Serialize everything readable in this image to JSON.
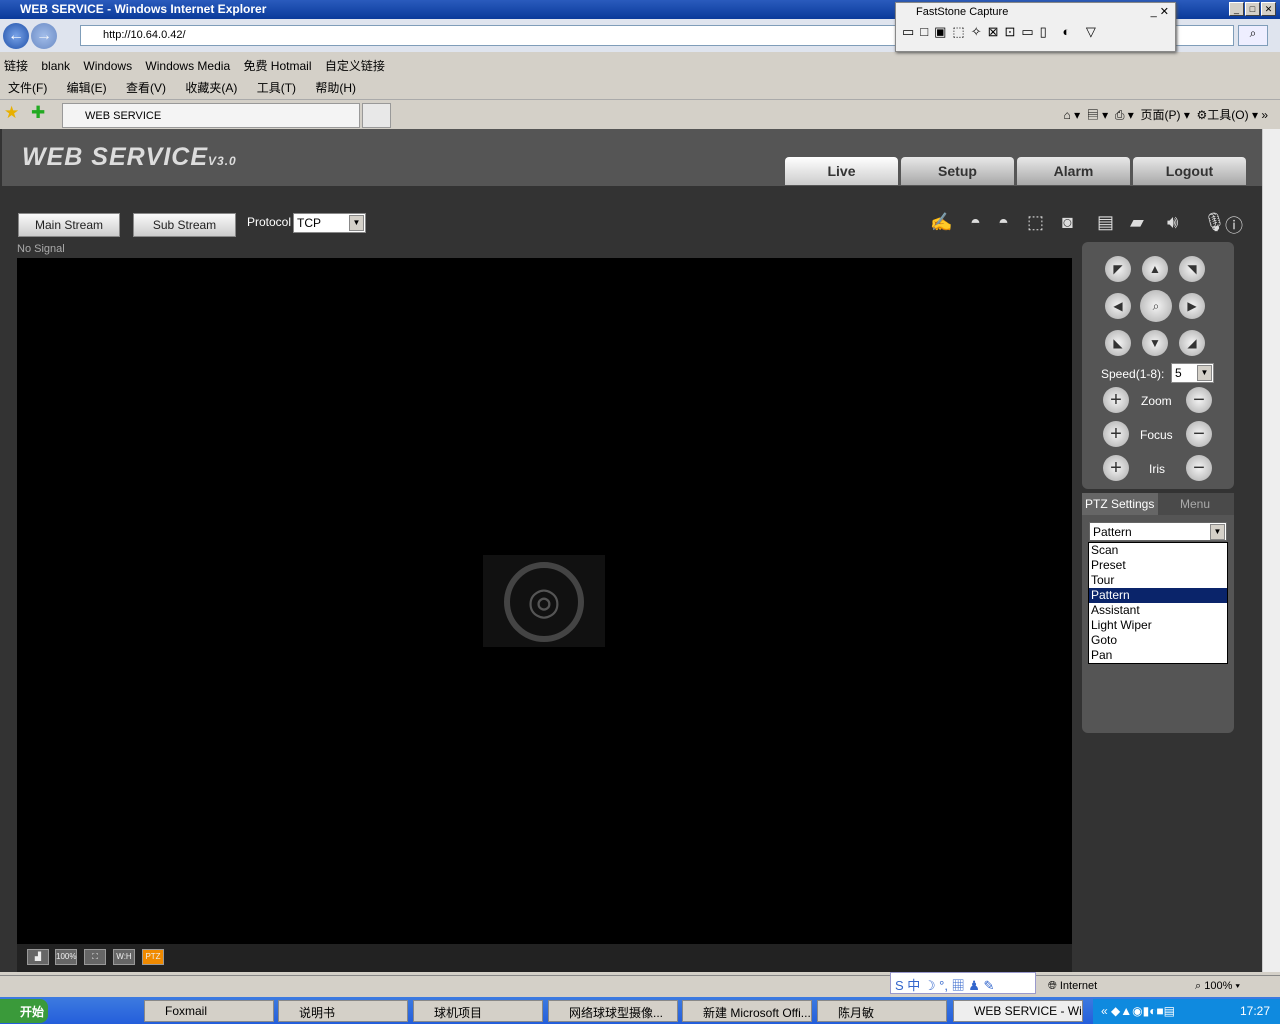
{
  "window": {
    "title": "WEB SERVICE - Windows Internet Explorer",
    "url": "http://10.64.0.42/",
    "tab": "WEB SERVICE"
  },
  "links": {
    "label": "链接",
    "items": [
      "blank",
      "Windows",
      "Windows Media",
      "免费 Hotmail",
      "自定义链接"
    ]
  },
  "menu": [
    "文件(F)",
    "编辑(E)",
    "查看(V)",
    "收藏夹(A)",
    "工具(T)",
    "帮助(H)"
  ],
  "toolbar": {
    "page": "页面(P)",
    "tools": "工具(O)"
  },
  "faststone": {
    "title": "FastStone Capture"
  },
  "app": {
    "logo": "WEB SERVICE",
    "version": "V3.0",
    "tabs": [
      "Live",
      "Setup",
      "Alarm",
      "Logout"
    ],
    "main_stream": "Main Stream",
    "sub_stream": "Sub Stream",
    "protocol_label": "Protocol",
    "protocol": "TCP",
    "no_signal": "No Signal",
    "video_buttons": [
      "100%",
      "W:H",
      "PTZ"
    ],
    "ptz": {
      "speed_label": "Speed(1-8):",
      "speed": "5",
      "zoom": "Zoom",
      "focus": "Focus",
      "iris": "Iris"
    },
    "ptz_settings": {
      "tab1": "PTZ Settings",
      "tab2": "Menu",
      "selected": "Pattern",
      "options": [
        "Scan",
        "Preset",
        "Tour",
        "Pattern",
        "Assistant",
        "Light Wiper",
        "Goto",
        "Pan"
      ]
    }
  },
  "status": {
    "zone": "Internet",
    "zoom": "100%"
  },
  "taskbar": {
    "start": "开始",
    "items": [
      "Foxmail",
      "说明书",
      "球机项目",
      "网络球球型摄像...",
      "新建 Microsoft Offi...",
      "陈月敏",
      "WEB SERVICE - Wi..."
    ],
    "clock": "17:27"
  }
}
